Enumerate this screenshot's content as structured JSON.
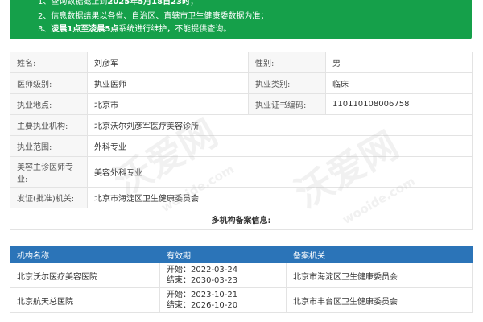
{
  "notice": {
    "line1_prefix": "1、查询数据截止到",
    "line1_bold": "2025年5月18日23时",
    "line1_suffix": "；",
    "line2": "2、信息数据结果以各省、自治区、直辖市卫生健康委数据为准；",
    "line3_prefix": "3、",
    "line3_bold": "凌晨1点至凌晨5点",
    "line3_suffix": "系统进行维护，不能提供查询。"
  },
  "info": {
    "name_label": "姓名:",
    "name_value": "刘彦军",
    "gender_label": "性别:",
    "gender_value": "男",
    "level_label": "医师级别:",
    "level_value": "执业医师",
    "category_label": "执业类别:",
    "category_value": "临床",
    "location_label": "执业地点:",
    "location_value": "北京市",
    "cert_label": "执业证书编码:",
    "cert_value": "110110108006758",
    "institution_label": "主要执业机构:",
    "institution_value": "北京沃尔刘彦军医疗美容诊所",
    "scope_label": "执业范围:",
    "scope_value": "外科专业",
    "cosmetic_label": "美容主诊医师专业:",
    "cosmetic_value": "美容外科专业",
    "issuer_label": "发证(批准)机关:",
    "issuer_value": "北京市海淀区卫生健康委员会",
    "multi_title": "多机构备案信息:"
  },
  "multi": {
    "headers": [
      "机构名称",
      "有效期",
      "备案机关"
    ],
    "rows": [
      {
        "name": "北京沃尔医疗美容医院",
        "start": "开始：2022-03-24",
        "end": "结束：2030-03-23",
        "authority": "北京市海淀区卫生健康委员会"
      },
      {
        "name": "北京航天总医院",
        "start": "开始：2023-10-21",
        "end": "结束：2026-10-20",
        "authority": "北京市丰台区卫生健康委员会"
      }
    ]
  },
  "watermark": {
    "cn": "沃爱网",
    "en": "wooide.com"
  }
}
